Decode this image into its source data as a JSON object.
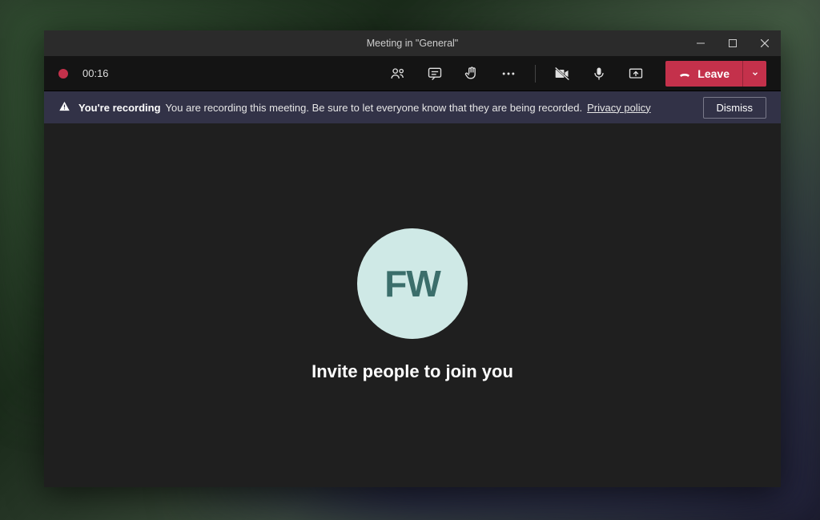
{
  "window": {
    "title": "Meeting in \"General\""
  },
  "toolbar": {
    "timer": "00:16",
    "leave_label": "Leave"
  },
  "banner": {
    "title": "You're recording",
    "message": "You are recording this meeting. Be sure to let everyone know that they are being recorded.",
    "policy_link": "Privacy policy",
    "dismiss_label": "Dismiss"
  },
  "main": {
    "avatar_initials": "FW",
    "invite_text": "Invite people to join you"
  }
}
